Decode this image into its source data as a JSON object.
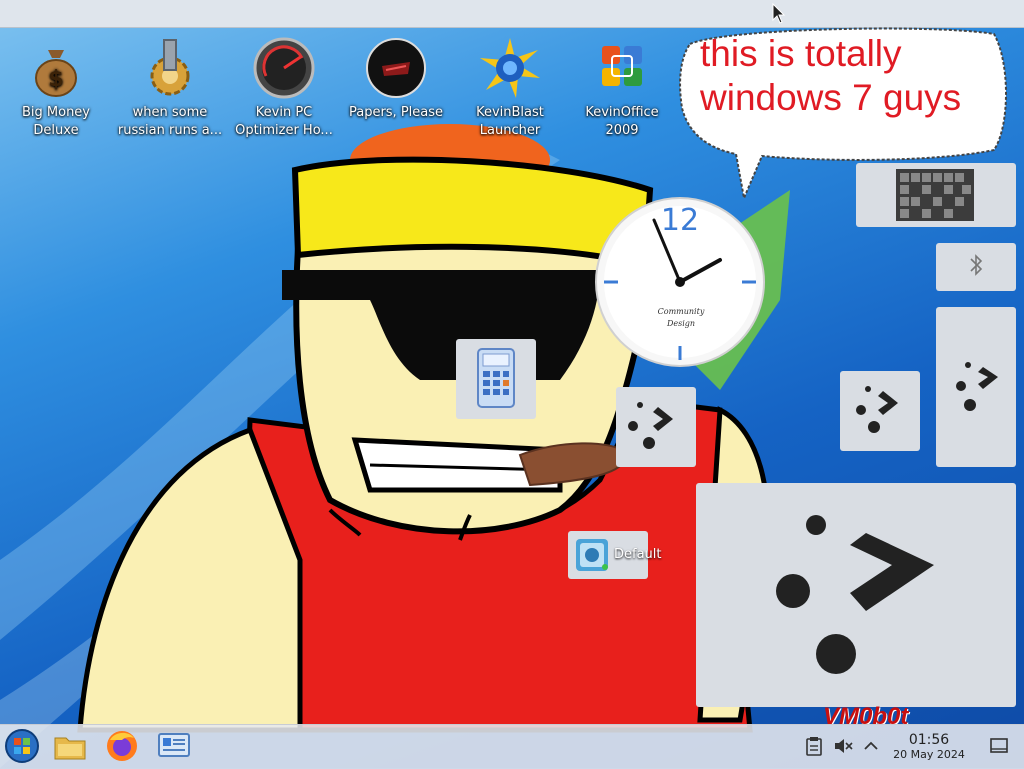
{
  "desktop": {
    "icons": [
      {
        "label": "Big Money Deluxe",
        "icon": "money-bag-icon"
      },
      {
        "label": "when some russian runs a...",
        "icon": "gear-icon"
      },
      {
        "label": "Kevin PC Optimizer Ho...",
        "icon": "speedometer-icon"
      },
      {
        "label": "Papers, Please",
        "icon": "papers-please-icon"
      },
      {
        "label": "KevinBlast Launcher",
        "icon": "kevinblast-icon"
      },
      {
        "label": "KevinOffice 2009",
        "icon": "office-icon"
      }
    ]
  },
  "bubble": {
    "line1": "this is totally",
    "line2": "windows 7 guys",
    "color": "#e01b24"
  },
  "clock_widget": {
    "hour_label": "12",
    "brand_line1": "Community",
    "brand_line2": "Design"
  },
  "widgets": {
    "default_label": "Default"
  },
  "watermark": "VM0b0t",
  "taskbar": {
    "items": [
      "start-orb-icon",
      "file-manager-icon",
      "firefox-icon",
      "control-panel-icon"
    ],
    "time": "01:56",
    "date": "20 May 2024",
    "tray": [
      "clipboard-icon",
      "volume-muted-icon",
      "chevron-up-icon",
      "show-desktop-icon"
    ]
  },
  "colors": {
    "accent_blue": "#3a7bd5",
    "panel_grey": "#d9dde3",
    "bubble_red": "#e01b24"
  }
}
